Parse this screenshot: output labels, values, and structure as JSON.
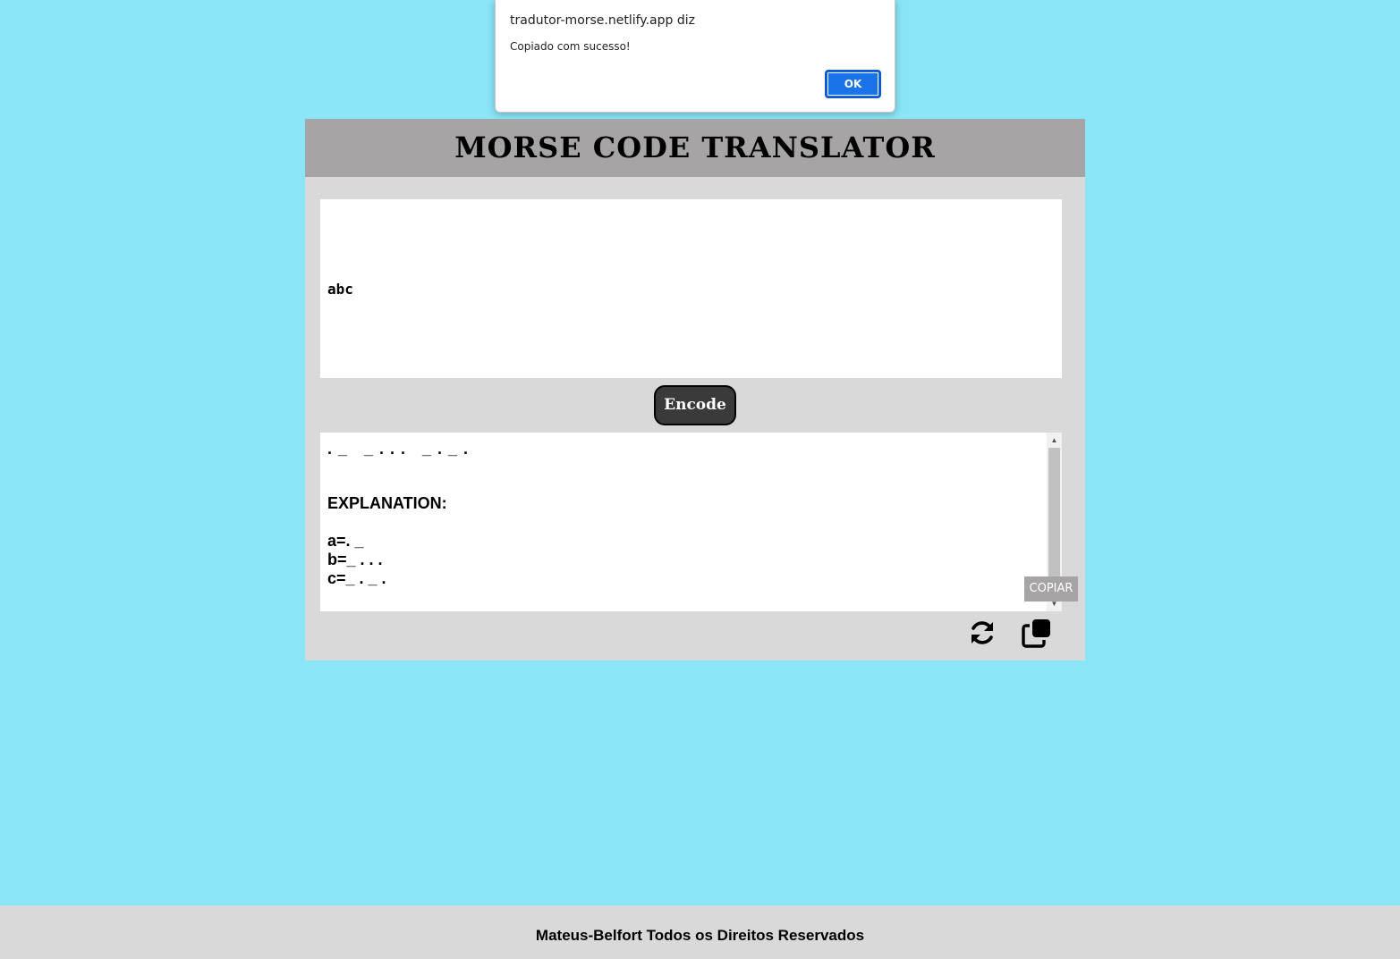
{
  "alert": {
    "title": "tradutor-morse.netlify.app diz",
    "message": "Copiado com sucesso!",
    "ok_label": "OK"
  },
  "translator": {
    "title": "MORSE CODE TRANSLATOR",
    "input_text": "abc",
    "encode_label": "Encode",
    "output": {
      "morse": ". _   _ . . .   _ . _ .",
      "explanation_heading": "EXPLANATION:",
      "explanation_items": [
        "a=. _",
        "b=_ . . .",
        "c=_ . _ ."
      ]
    },
    "copy_tooltip": "COPIAR",
    "icons": {
      "refresh": "refresh-icon",
      "copy": "copy-icon"
    }
  },
  "footer": {
    "text": "Mateus-Belfort Todos os Direitos Reservados"
  },
  "colors": {
    "page_background": "#8ae5f7",
    "card_background": "#d9d9d9",
    "header_background": "#a6a4a4",
    "encode_button": "#3a3a3a",
    "alert_button": "#1a73e8"
  }
}
